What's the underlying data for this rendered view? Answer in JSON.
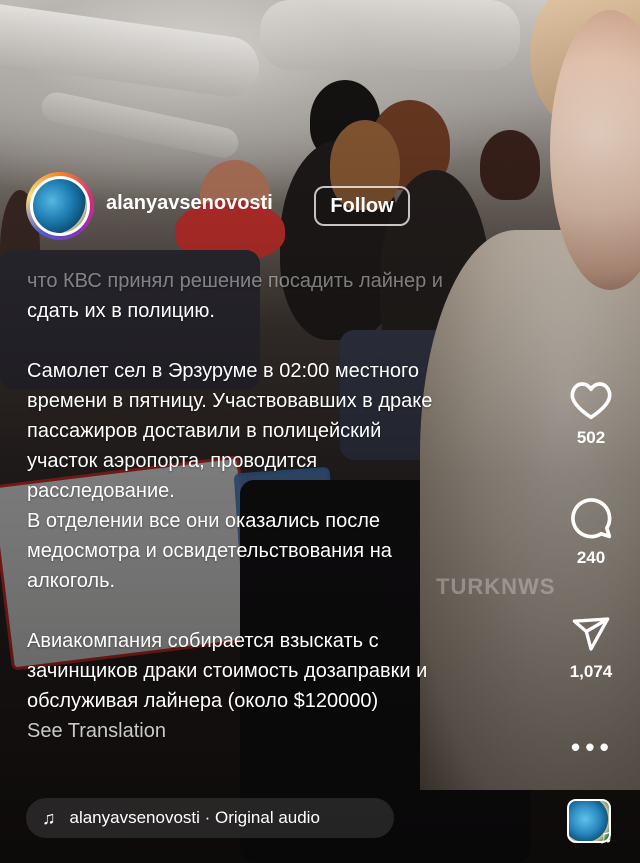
{
  "account": {
    "username": "alanyavsenovosti",
    "follow_label": "Follow"
  },
  "caption": {
    "faded_line": "что КВС принял решение посадить лайнер и",
    "lines_1": "сдать их в полицию.",
    "paragraph_2": "Самолет сел в Эрзуруме в 02:00 местного\nвремени в пятницу. Участвовавших в драке\nпассажиров доставили в полицейский\nучасток аэропорта, проводится\nрасследование.\nВ отделении все они оказались после\nмедосмотра и освидетельствования на\nалкоголь.",
    "paragraph_3": "Авиакомпания собирается взыскать с\nзачинщиков драки стоимость дозаправки и\nобслуживая лайнера (около $120000)",
    "see_translation": "See Translation"
  },
  "watermark": "TURKNWS",
  "actions": {
    "likes": "502",
    "comments": "240",
    "shares": "1,074",
    "like_icon": "heart-icon",
    "comment_icon": "comment-bubble-icon",
    "share_icon": "paper-plane-icon",
    "more_icon": "more-horizontal-icon"
  },
  "audio": {
    "label": "alanyavsenovosti · Original audio",
    "icon": "music-note-icon"
  },
  "colors": {
    "text": "#ffffff",
    "pill_bg": "rgba(60,60,60,0.55)"
  }
}
